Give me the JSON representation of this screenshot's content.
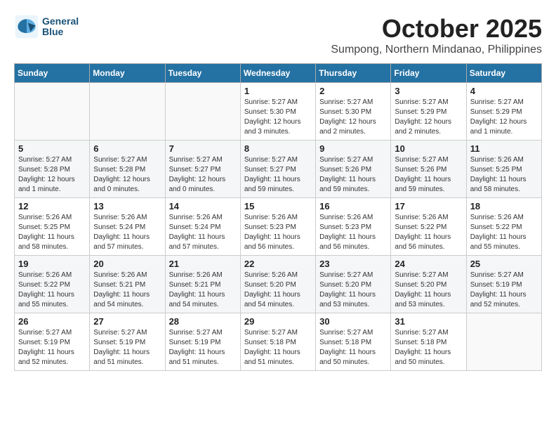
{
  "header": {
    "logo_line1": "General",
    "logo_line2": "Blue",
    "month": "October 2025",
    "location": "Sumpong, Northern Mindanao, Philippines"
  },
  "weekdays": [
    "Sunday",
    "Monday",
    "Tuesday",
    "Wednesday",
    "Thursday",
    "Friday",
    "Saturday"
  ],
  "weeks": [
    [
      {
        "day": "",
        "info": ""
      },
      {
        "day": "",
        "info": ""
      },
      {
        "day": "",
        "info": ""
      },
      {
        "day": "1",
        "info": "Sunrise: 5:27 AM\nSunset: 5:30 PM\nDaylight: 12 hours\nand 3 minutes."
      },
      {
        "day": "2",
        "info": "Sunrise: 5:27 AM\nSunset: 5:30 PM\nDaylight: 12 hours\nand 2 minutes."
      },
      {
        "day": "3",
        "info": "Sunrise: 5:27 AM\nSunset: 5:29 PM\nDaylight: 12 hours\nand 2 minutes."
      },
      {
        "day": "4",
        "info": "Sunrise: 5:27 AM\nSunset: 5:29 PM\nDaylight: 12 hours\nand 1 minute."
      }
    ],
    [
      {
        "day": "5",
        "info": "Sunrise: 5:27 AM\nSunset: 5:28 PM\nDaylight: 12 hours\nand 1 minute."
      },
      {
        "day": "6",
        "info": "Sunrise: 5:27 AM\nSunset: 5:28 PM\nDaylight: 12 hours\nand 0 minutes."
      },
      {
        "day": "7",
        "info": "Sunrise: 5:27 AM\nSunset: 5:27 PM\nDaylight: 12 hours\nand 0 minutes."
      },
      {
        "day": "8",
        "info": "Sunrise: 5:27 AM\nSunset: 5:27 PM\nDaylight: 11 hours\nand 59 minutes."
      },
      {
        "day": "9",
        "info": "Sunrise: 5:27 AM\nSunset: 5:26 PM\nDaylight: 11 hours\nand 59 minutes."
      },
      {
        "day": "10",
        "info": "Sunrise: 5:27 AM\nSunset: 5:26 PM\nDaylight: 11 hours\nand 59 minutes."
      },
      {
        "day": "11",
        "info": "Sunrise: 5:26 AM\nSunset: 5:25 PM\nDaylight: 11 hours\nand 58 minutes."
      }
    ],
    [
      {
        "day": "12",
        "info": "Sunrise: 5:26 AM\nSunset: 5:25 PM\nDaylight: 11 hours\nand 58 minutes."
      },
      {
        "day": "13",
        "info": "Sunrise: 5:26 AM\nSunset: 5:24 PM\nDaylight: 11 hours\nand 57 minutes."
      },
      {
        "day": "14",
        "info": "Sunrise: 5:26 AM\nSunset: 5:24 PM\nDaylight: 11 hours\nand 57 minutes."
      },
      {
        "day": "15",
        "info": "Sunrise: 5:26 AM\nSunset: 5:23 PM\nDaylight: 11 hours\nand 56 minutes."
      },
      {
        "day": "16",
        "info": "Sunrise: 5:26 AM\nSunset: 5:23 PM\nDaylight: 11 hours\nand 56 minutes."
      },
      {
        "day": "17",
        "info": "Sunrise: 5:26 AM\nSunset: 5:22 PM\nDaylight: 11 hours\nand 56 minutes."
      },
      {
        "day": "18",
        "info": "Sunrise: 5:26 AM\nSunset: 5:22 PM\nDaylight: 11 hours\nand 55 minutes."
      }
    ],
    [
      {
        "day": "19",
        "info": "Sunrise: 5:26 AM\nSunset: 5:22 PM\nDaylight: 11 hours\nand 55 minutes."
      },
      {
        "day": "20",
        "info": "Sunrise: 5:26 AM\nSunset: 5:21 PM\nDaylight: 11 hours\nand 54 minutes."
      },
      {
        "day": "21",
        "info": "Sunrise: 5:26 AM\nSunset: 5:21 PM\nDaylight: 11 hours\nand 54 minutes."
      },
      {
        "day": "22",
        "info": "Sunrise: 5:26 AM\nSunset: 5:20 PM\nDaylight: 11 hours\nand 54 minutes."
      },
      {
        "day": "23",
        "info": "Sunrise: 5:27 AM\nSunset: 5:20 PM\nDaylight: 11 hours\nand 53 minutes."
      },
      {
        "day": "24",
        "info": "Sunrise: 5:27 AM\nSunset: 5:20 PM\nDaylight: 11 hours\nand 53 minutes."
      },
      {
        "day": "25",
        "info": "Sunrise: 5:27 AM\nSunset: 5:19 PM\nDaylight: 11 hours\nand 52 minutes."
      }
    ],
    [
      {
        "day": "26",
        "info": "Sunrise: 5:27 AM\nSunset: 5:19 PM\nDaylight: 11 hours\nand 52 minutes."
      },
      {
        "day": "27",
        "info": "Sunrise: 5:27 AM\nSunset: 5:19 PM\nDaylight: 11 hours\nand 51 minutes."
      },
      {
        "day": "28",
        "info": "Sunrise: 5:27 AM\nSunset: 5:19 PM\nDaylight: 11 hours\nand 51 minutes."
      },
      {
        "day": "29",
        "info": "Sunrise: 5:27 AM\nSunset: 5:18 PM\nDaylight: 11 hours\nand 51 minutes."
      },
      {
        "day": "30",
        "info": "Sunrise: 5:27 AM\nSunset: 5:18 PM\nDaylight: 11 hours\nand 50 minutes."
      },
      {
        "day": "31",
        "info": "Sunrise: 5:27 AM\nSunset: 5:18 PM\nDaylight: 11 hours\nand 50 minutes."
      },
      {
        "day": "",
        "info": ""
      }
    ]
  ]
}
